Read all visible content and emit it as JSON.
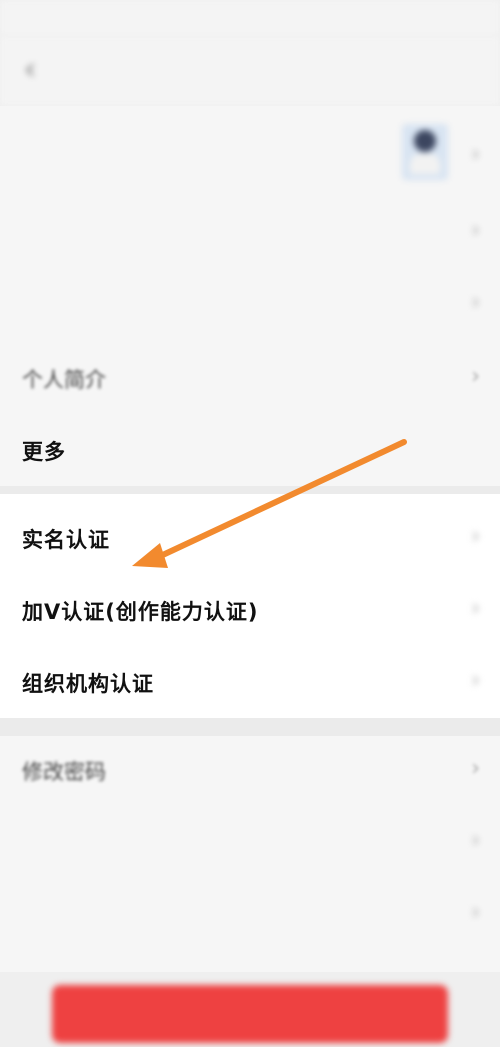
{
  "status_bar": {
    "left_text": "",
    "right_text": ""
  },
  "nav": {
    "back_icon": "chevron-left-icon",
    "title": ""
  },
  "profile_rows": [
    {
      "label": "",
      "value": "",
      "has_avatar": true
    },
    {
      "label": "",
      "value": ""
    },
    {
      "label": "",
      "value": ""
    },
    {
      "label": "个人简介",
      "value": ""
    },
    {
      "label": "更多",
      "value": ""
    }
  ],
  "verification_rows": [
    {
      "label": "实名认证",
      "value": ""
    },
    {
      "label": "加V认证(创作能力认证)",
      "value": ""
    },
    {
      "label": "组织机构认证",
      "value": ""
    }
  ],
  "security_rows": [
    {
      "label": "修改密码",
      "value": ""
    },
    {
      "label": "",
      "value": ""
    },
    {
      "label": "",
      "value": ""
    }
  ],
  "submit_button": {
    "label": ""
  },
  "colors": {
    "accent_red": "#ee4141",
    "annotation_arrow": "#f28a2e"
  }
}
